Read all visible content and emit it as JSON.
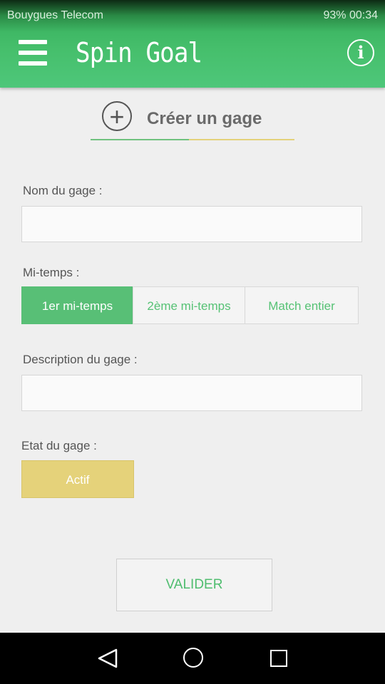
{
  "status_bar": {
    "carrier": "Bouygues Telecom",
    "battery": "93%",
    "time": "00:34"
  },
  "app_bar": {
    "title": "Spin Goal",
    "menu_icon": "hamburger-menu-icon",
    "info_icon": "info-icon",
    "info_glyph": "i"
  },
  "form": {
    "header": {
      "icon": "plus-circle-icon",
      "plus_glyph": "+",
      "title": "Créer un gage"
    },
    "name": {
      "label": "Nom du gage :",
      "value": ""
    },
    "period": {
      "label": "Mi-temps :",
      "options": [
        "1er mi-temps",
        "2ème mi-temps",
        "Match entier"
      ],
      "selected": "1er mi-temps"
    },
    "description": {
      "label": "Description du gage :",
      "value": ""
    },
    "state": {
      "label": "Etat du gage :",
      "value": "Actif"
    },
    "submit_label": "VALIDER"
  },
  "colors": {
    "primary_green": "#4ec77a",
    "accent_yellow": "#e5d27a"
  },
  "nav_bar": {
    "icons": [
      "back-icon",
      "home-icon",
      "recent-apps-icon"
    ]
  }
}
